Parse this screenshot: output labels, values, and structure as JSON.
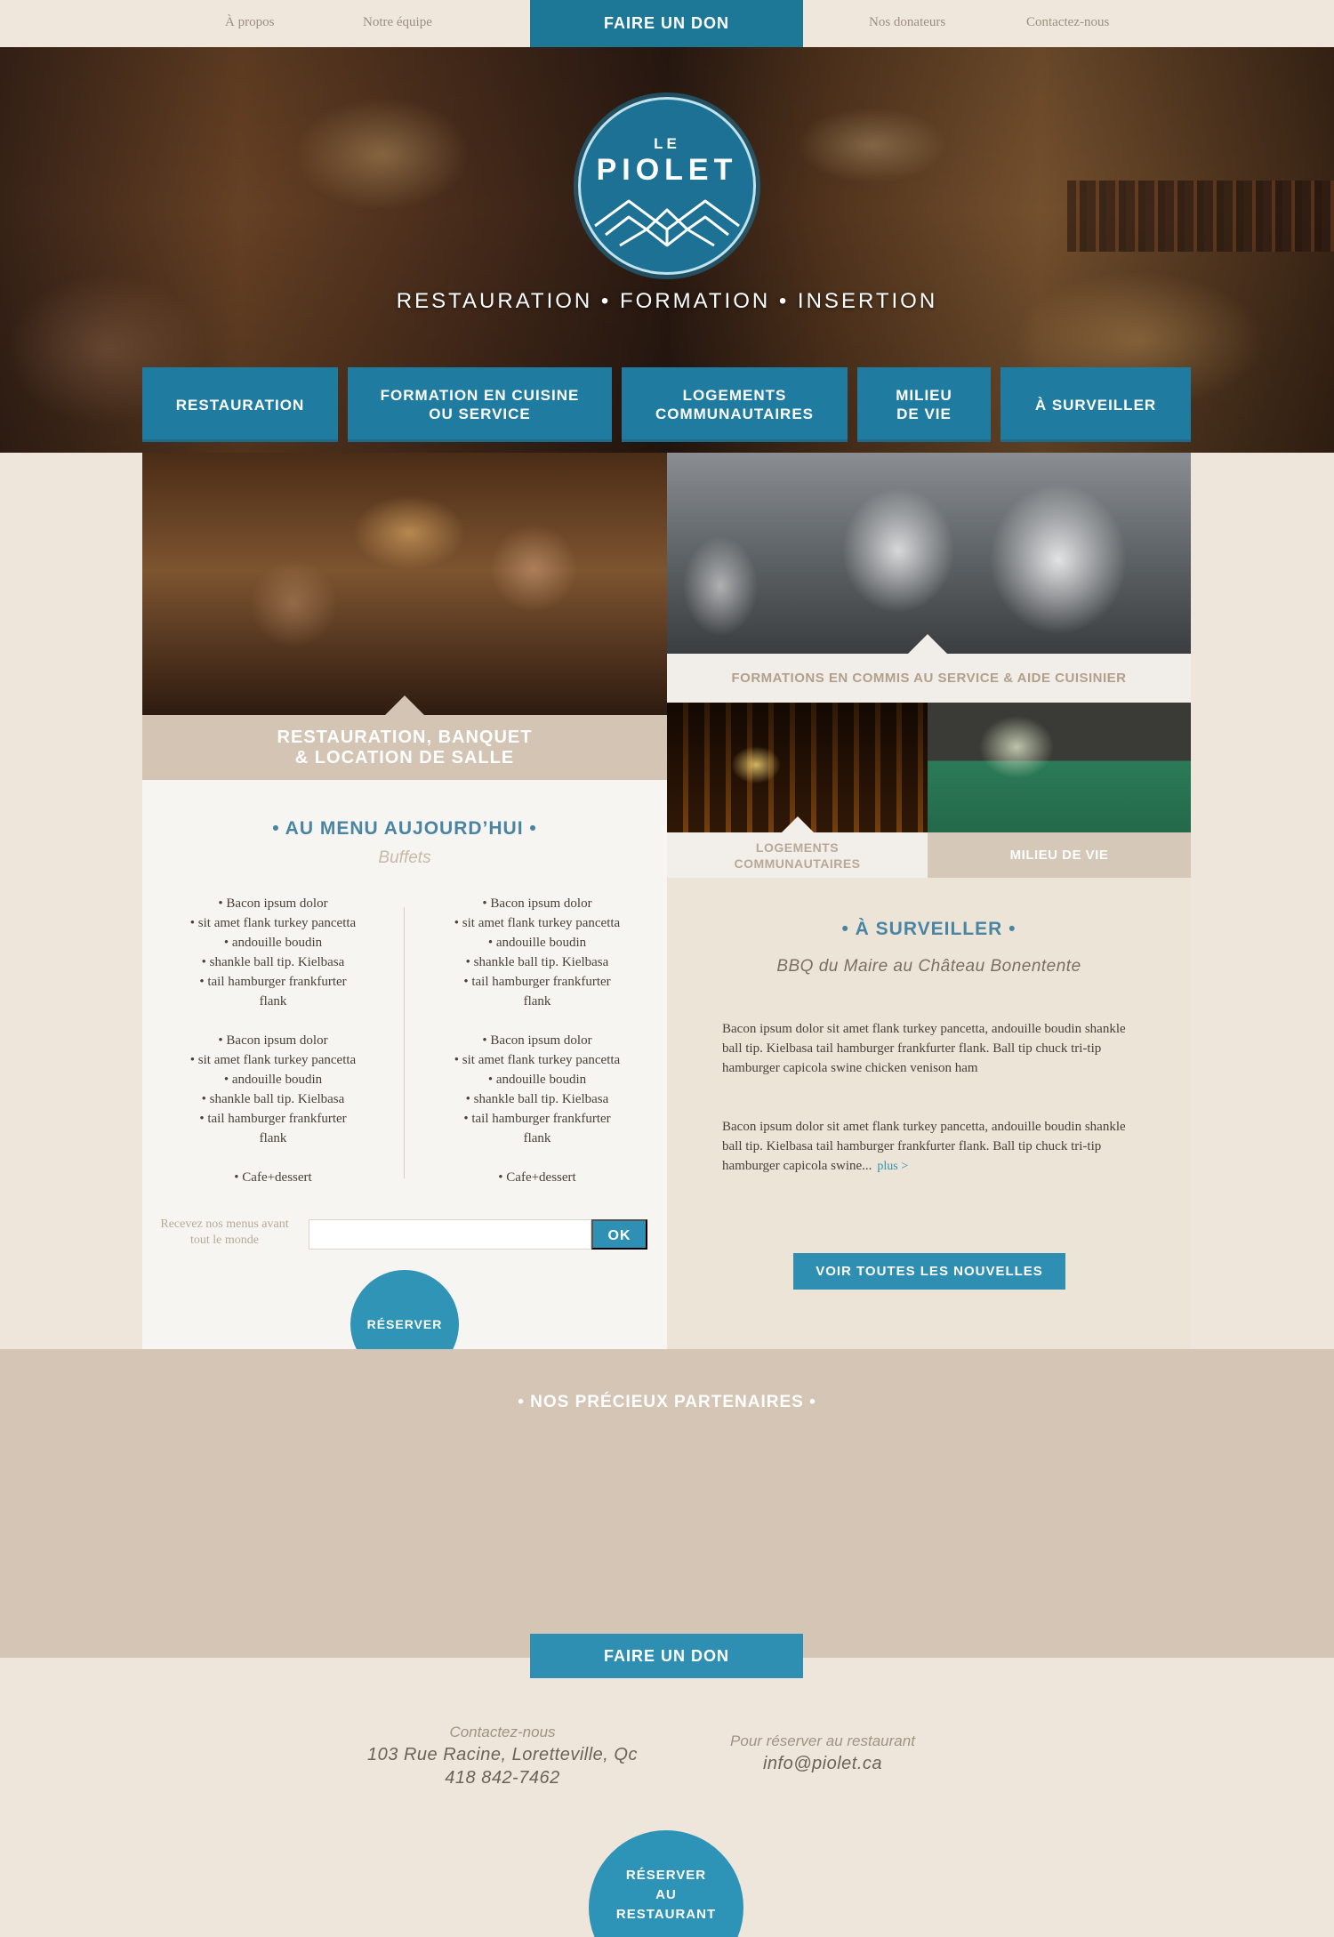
{
  "topnav": {
    "about": "À propos",
    "team": "Notre équipe",
    "donate": "FAIRE UN DON",
    "donors": "Nos donateurs",
    "contact": "Contactez-nous"
  },
  "hero": {
    "logo_le": "LE",
    "logo_name": "PIOLET",
    "tagline": "RESTAURATION • FORMATION • INSERTION"
  },
  "mainnav": [
    "RESTAURATION",
    "FORMATION EN CUISINE OU SERVICE",
    "LOGEMENTS COMMUNAUTAIRES",
    "MILIEU DE VIE",
    "À SURVEILLER"
  ],
  "mainnav_lines": {
    "formation": [
      "FORMATION EN CUISINE",
      "OU SERVICE"
    ],
    "logements": [
      "LOGEMENTS",
      "COMMUNAUTAIRES"
    ],
    "milieu": [
      "MILIEU",
      "DE VIE"
    ]
  },
  "blocks": {
    "resto_line1": "RESTAURATION, BANQUET",
    "resto_line2": "& LOCATION DE SALLE",
    "formation": "FORMATIONS EN COMMIS AU SERVICE & AIDE CUISINIER",
    "logis_line1": "LOGEMENTS",
    "logis_line2": "COMMUNAUTAIRES",
    "milieu": "MILIEU DE VIE"
  },
  "menu": {
    "title": "• AU MENU AUJOURD’HUI •",
    "subtitle": "Buffets",
    "group_lines": [
      "• Bacon ipsum dolor",
      "• sit amet flank turkey pancetta",
      "• andouille boudin",
      "• shankle ball tip. Kielbasa",
      "• tail hamburger frankfurter",
      "flank"
    ],
    "dessert": "• Cafe+dessert",
    "newsletter_label": "Recevez nos menus avant tout le monde",
    "newsletter_ok": "OK",
    "reserve": "RÉSERVER"
  },
  "news": {
    "title": "• À SURVEILLER •",
    "subtitle": "BBQ du Maire au Château Bonentente",
    "p1": "Bacon ipsum dolor sit amet flank turkey pancetta, andouille boudin shankle ball tip. Kielbasa tail hamburger frankfurter flank. Ball tip chuck tri-tip hamburger capicola swine chicken venison ham",
    "p2": "Bacon ipsum dolor sit amet flank turkey pancetta, andouille boudin shankle ball tip. Kielbasa tail hamburger frankfurter flank. Ball tip chuck tri-tip hamburger capicola swine...",
    "more": "plus >",
    "all_news": "VOIR TOUTES LES NOUVELLES"
  },
  "partners": {
    "title": "• NOS PRÉCIEUX PARTENAIRES •",
    "donate": "FAIRE UN DON"
  },
  "footer": {
    "contact_label": "Contactez-nous",
    "address": "103 Rue Racine, Loretteville, Qc",
    "phone": "418 842-7462",
    "reserve_label": "Pour réserver au restaurant",
    "email": "info@piolet.ca",
    "reserve_btn": [
      "RÉSERVER",
      "AU",
      "RESTAURANT"
    ]
  },
  "colors": {
    "accent": "#1f7ca0",
    "beige": "#efe6db",
    "taupe": "#d4c5b4",
    "heading_blue": "#4a84a3"
  }
}
